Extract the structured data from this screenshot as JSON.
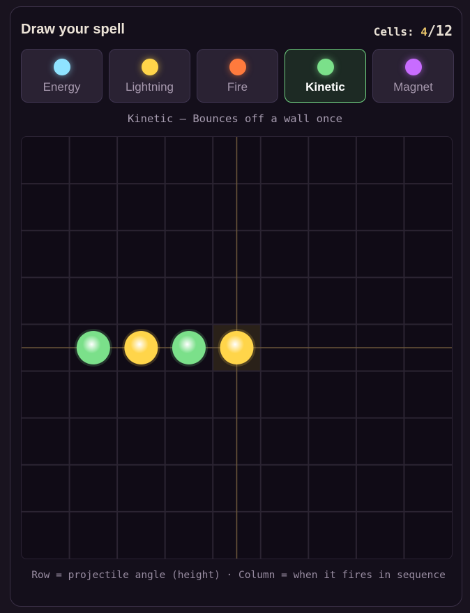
{
  "header": {
    "title": "Draw your spell",
    "cells_label": "Cells: ",
    "cells_used": "4",
    "cells_sep": "/",
    "cells_max": "12"
  },
  "spells": [
    {
      "label": "Energy",
      "color": "#8fe3ff"
    },
    {
      "label": "Lightning",
      "color": "#ffd54a"
    },
    {
      "label": "Fire",
      "color": "#ff7a3d"
    },
    {
      "label": "Kinetic",
      "color": "#7be08a",
      "selected": true
    },
    {
      "label": "Magnet",
      "color": "#c86cff"
    }
  ],
  "description": "Kinetic — Bounces off a wall once",
  "grid": {
    "columns": 9,
    "rows": 9,
    "cursor": {
      "row": 4,
      "col": 4
    },
    "placed": [
      {
        "row": 4,
        "col": 1,
        "spell": "Kinetic",
        "color": "#7be08a"
      },
      {
        "row": 4,
        "col": 2,
        "spell": "Lightning",
        "color": "#ffd54a"
      },
      {
        "row": 4,
        "col": 3,
        "spell": "Kinetic",
        "color": "#7be08a"
      },
      {
        "row": 4,
        "col": 4,
        "spell": "Lightning",
        "color": "#ffd54a"
      }
    ]
  },
  "footer": "Row = projectile angle (height) · Column = when it fires in sequence"
}
